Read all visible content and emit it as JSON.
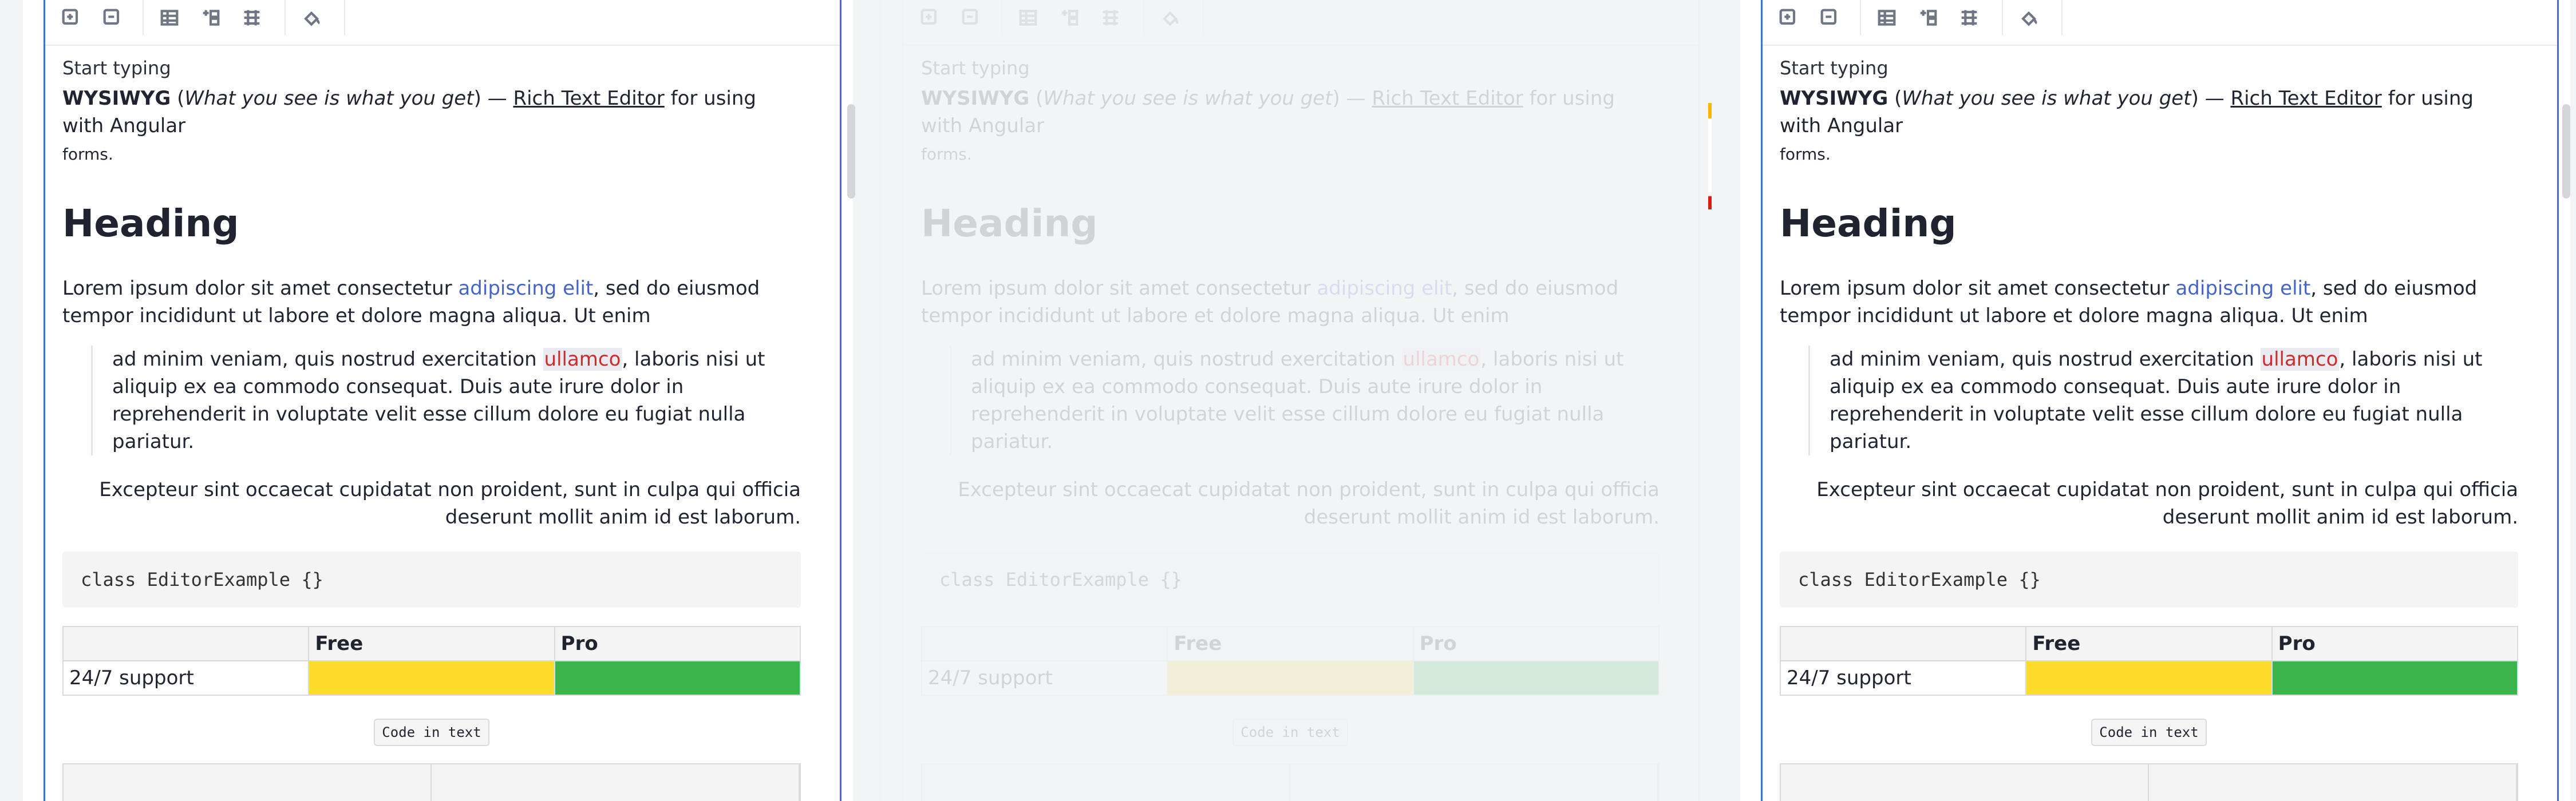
{
  "panels": [
    {
      "placeholder": "Start typing",
      "intro": {
        "brand": "WYSIWYG",
        "paren": "What you see is what you get",
        "dash": "—",
        "rte": "Rich Text Editor",
        "rest": "for using with Angular",
        "tail": "forms."
      },
      "heading": "Heading",
      "para": {
        "text_before": "Lorem ipsum dolor sit amet consectetur ",
        "link": "adipiscing elit",
        "text_after": ", sed do eiusmod tempor incididunt ut labore et dolore magna aliqua. Ut enim"
      },
      "quote": {
        "before": "ad minim veniam, quis nostrud exercitation ",
        "highlight": "ullamco",
        "after": ", laboris nisi ut aliquip ex ea commodo consequat. Duis aute irure dolor in reprehenderit in voluptate velit esse cillum dolore eu fugiat nulla pariatur."
      },
      "right": "Excepteur sint occaecat cupidatat non proident, sunt in culpa qui officia deserunt mollit anim id est laborum.",
      "code": "class EditorExample {}",
      "table": {
        "headers": [
          "",
          "Free",
          "Pro"
        ],
        "row_label": "24/7 support"
      },
      "inline_code": "Code in text"
    },
    {
      "placeholder": "Start typing",
      "intro": {
        "brand": "WYSIWYG",
        "paren": "What you see is what you get",
        "dash": "—",
        "rte": "Rich Text Editor",
        "rest": "for using with Angular",
        "tail": "forms."
      },
      "heading": "Heading",
      "para": {
        "text_before": "Lorem ipsum dolor sit amet consectetur ",
        "link": "adipiscing elit",
        "text_after": ", sed do eiusmod tempor incididunt ut labore et dolore magna aliqua. Ut enim"
      },
      "quote": {
        "before": "ad minim veniam, quis nostrud exercitation ",
        "highlight": "ullamco",
        "after": ", laboris nisi ut aliquip ex ea commodo consequat. Duis aute irure dolor in reprehenderit in voluptate velit esse cillum dolore eu fugiat nulla pariatur."
      },
      "right": "Excepteur sint occaecat cupidatat non proident, sunt in culpa qui officia deserunt mollit anim id est laborum.",
      "code": "class EditorExample {}",
      "table": {
        "headers": [
          "",
          "Free",
          "Pro"
        ],
        "row_label": "24/7 support"
      },
      "inline_code": "Code in text"
    },
    {
      "placeholder": "Start typing",
      "intro": {
        "brand": "WYSIWYG",
        "paren": "What you see is what you get",
        "dash": "—",
        "rte": "Rich Text Editor",
        "rest": "for using with Angular",
        "tail": "forms."
      },
      "heading": "Heading",
      "para": {
        "text_before": "Lorem ipsum dolor sit amet consectetur ",
        "link": "adipiscing elit",
        "text_after": ", sed do eiusmod tempor incididunt ut labore et dolore magna aliqua. Ut enim"
      },
      "quote": {
        "before": "ad minim veniam, quis nostrud exercitation ",
        "highlight": "ullamco",
        "after": ", laboris nisi ut aliquip ex ea commodo consequat. Duis aute irure dolor in reprehenderit in voluptate velit esse cillum dolore eu fugiat nulla pariatur."
      },
      "right": "Excepteur sint occaecat cupidatat non proident, sunt in culpa qui officia deserunt mollit anim id est laborum.",
      "code": "class EditorExample {}",
      "table": {
        "headers": [
          "",
          "Free",
          "Pro"
        ],
        "row_label": "24/7 support"
      },
      "inline_code": "Code in text"
    }
  ],
  "colors": {
    "accent": "#3f6fd1",
    "link": "#4663c8",
    "yellow": "#fddb2b",
    "green": "#39b54a",
    "highlight": "#d12a2a"
  },
  "icons": [
    "add-row-icon",
    "remove-row-icon",
    "table-icon",
    "merge-cells-icon",
    "split-cells-icon",
    "paint-bucket-icon"
  ]
}
